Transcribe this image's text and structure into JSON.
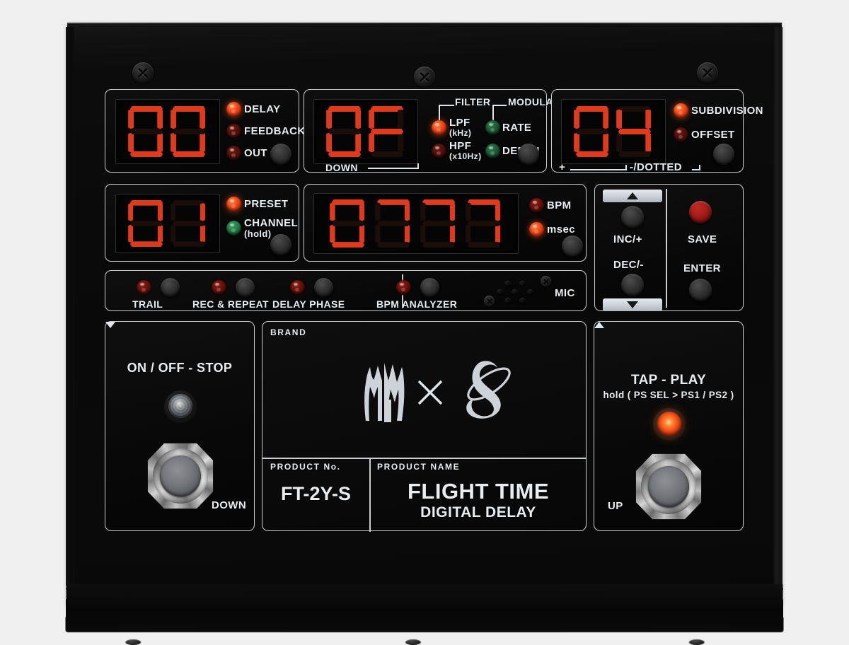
{
  "device": {
    "brand_label": "BRAND",
    "product_no_label": "PRODUCT No.",
    "product_name_label": "PRODUCT NAME",
    "product_no": "FT-2Y-S",
    "product_name": "FLIGHT TIME",
    "product_subtitle": "DIGITAL DELAY",
    "logo_separator": "×"
  },
  "colors": {
    "led_red_on": "#f4491a",
    "led_red_off": "#551009",
    "led_green_off": "#1c5c36",
    "segment_red": "#e03a1c",
    "panel_outline": "#c9ced3",
    "label_text": "#e9edf0",
    "save_button_red": "#a51d18"
  },
  "panel_delay": {
    "display_value": "00",
    "leds": [
      {
        "label": "DELAY",
        "color": "red",
        "state": "on"
      },
      {
        "label": "FEEDBACK",
        "color": "red",
        "state": "off"
      },
      {
        "label": "OUT",
        "color": "red",
        "state": "off"
      }
    ],
    "button": "select-knob"
  },
  "panel_filter_mod": {
    "display_value": "0F",
    "under_label": "DOWN",
    "group_filter": "FILTER",
    "group_modulation": "MODULATION",
    "leds": [
      {
        "label": "LPF",
        "sub": "(kHz)",
        "color": "red",
        "state": "on"
      },
      {
        "label": "HPF",
        "sub": "(x10Hz)",
        "color": "red",
        "state": "off"
      },
      {
        "label": "RATE",
        "sub": "",
        "color": "green",
        "state": "off"
      },
      {
        "label": "DEPTH",
        "sub": "",
        "color": "green",
        "state": "off"
      }
    ]
  },
  "panel_subdivision": {
    "display_value": "04",
    "scale_left": "+",
    "scale_right": "-/DOTTED",
    "leds": [
      {
        "label": "SUBDIVISION",
        "color": "red",
        "state": "on"
      },
      {
        "label": "OFFSET",
        "color": "red",
        "state": "off"
      }
    ]
  },
  "panel_preset": {
    "display_value": "01",
    "leds": [
      {
        "label": "PRESET",
        "sub": "",
        "color": "red",
        "state": "on"
      },
      {
        "label": "CHANNEL",
        "sub": "(hold)",
        "color": "green",
        "state": "on"
      }
    ]
  },
  "panel_time": {
    "display_value": "0777",
    "leds": [
      {
        "label": "BPM",
        "color": "red",
        "state": "off"
      },
      {
        "label": "msec",
        "color": "red",
        "state": "on"
      }
    ]
  },
  "panel_incdec": {
    "up_arrow": "▲",
    "down_arrow": "▼",
    "inc_label": "INC/+",
    "dec_label": "DEC/-"
  },
  "panel_saveenter": {
    "save_label": "SAVE",
    "enter_label": "ENTER"
  },
  "panel_switches": [
    {
      "label": "TRAIL",
      "led_state": "off"
    },
    {
      "label": "REC & REPEAT",
      "led_state": "off"
    },
    {
      "label": "DELAY PHASE",
      "led_state": "off"
    },
    {
      "label": "BPM ANALYZER",
      "led_state": "off"
    }
  ],
  "panel_mic": {
    "label": "MIC"
  },
  "panel_left_foot": {
    "title": "ON / OFF - STOP",
    "lamp_state": "clear",
    "direction_label": "DOWN",
    "direction_arrow": "▼"
  },
  "panel_right_foot": {
    "title": "TAP - PLAY",
    "subtitle": "hold ( PS SEL > PS1 / PS2 )",
    "lamp_state": "lit",
    "direction_label": "UP",
    "direction_arrow": "▲"
  }
}
